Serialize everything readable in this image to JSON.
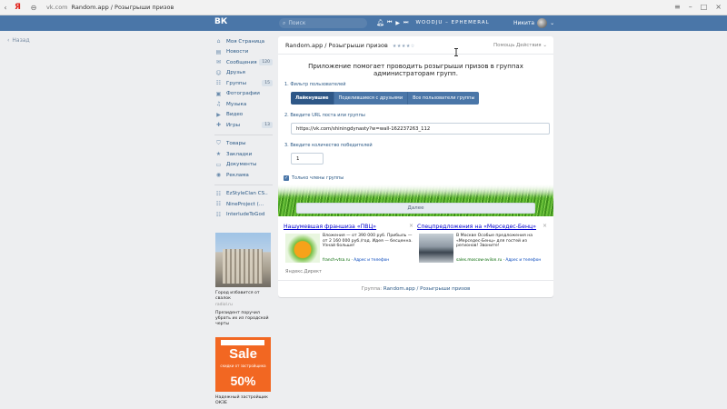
{
  "browser": {
    "logo": "Я",
    "domain": "vk.com",
    "page_title": "Random.app / Розыгрыши призов"
  },
  "header": {
    "logo": "ВК",
    "search_placeholder": "Поиск",
    "track": "WOODJU – EPHEMERAL",
    "user_name": "Никита"
  },
  "back_label": "Назад",
  "sidebar": {
    "items": [
      {
        "icon": "home-icon",
        "glyph": "⌂",
        "label": "Моя Страница",
        "count": ""
      },
      {
        "icon": "news-icon",
        "glyph": "▤",
        "label": "Новости",
        "count": ""
      },
      {
        "icon": "messages-icon",
        "glyph": "✉",
        "label": "Сообщения",
        "count": "120"
      },
      {
        "icon": "friends-icon",
        "glyph": "☺",
        "label": "Друзья",
        "count": ""
      },
      {
        "icon": "groups-icon",
        "glyph": "☷",
        "label": "Группы",
        "count": "15"
      },
      {
        "icon": "photos-icon",
        "glyph": "▣",
        "label": "Фотографии",
        "count": ""
      },
      {
        "icon": "music-icon",
        "glyph": "♫",
        "label": "Музыка",
        "count": ""
      },
      {
        "icon": "video-icon",
        "glyph": "▶",
        "label": "Видео",
        "count": ""
      },
      {
        "icon": "games-icon",
        "glyph": "✚",
        "label": "Игры",
        "count": "13"
      }
    ],
    "items2": [
      {
        "icon": "goods-icon",
        "glyph": "⛉",
        "label": "Товары"
      },
      {
        "icon": "bookmarks-icon",
        "glyph": "★",
        "label": "Закладки"
      },
      {
        "icon": "documents-icon",
        "glyph": "▭",
        "label": "Документы"
      },
      {
        "icon": "ads-icon",
        "glyph": "◉",
        "label": "Реклама"
      }
    ],
    "groups": [
      "EzStyleClan CS..",
      "NineProject (...",
      "InterludeToGod"
    ]
  },
  "ads": {
    "ad1": {
      "title": "Город избавится от свалок",
      "domain": "radiol.ru",
      "text": "Президент поручил убрать их из городской черты"
    },
    "ad2": {
      "sale": "Sale",
      "sub": "скидки от застройщика",
      "pct": "50%",
      "title": "Надежный застройщик ОКЗЕ"
    }
  },
  "app": {
    "title": "Random.app / Розыгрыши призов",
    "stars": "★★★★☆",
    "help": "Помощь",
    "actions": "Действия ⌄",
    "intro": "Приложение помогает проводить розыгрыши призов в группах администраторам групп.",
    "step1_label": "1. Фильтр пользователей",
    "filters": [
      "Лайкнувшие",
      "Поделившиеся с друзьями",
      "Все пользователи группы"
    ],
    "step2_label": "2. Введите URL поста или группы",
    "url_value": "https://vk.com/shiningdynasty?w=wall-162237263_112",
    "step3_label": "3. Введите количество победителей",
    "winners_value": "1",
    "only_members": "Только члены группы",
    "next_button": "Далее"
  },
  "direct": {
    "ad1": {
      "title": "Нашумевшая франшиза «ПВЦ»",
      "body": "Вложения — от 390 000 руб. Прибыль — от 2 160 000 руб./год. Идея — бесценна. Узнай больше!",
      "domain": "franch-vtsa.ru",
      "addr": "Адрес и телефон"
    },
    "ad2": {
      "title": "Спецпредложения на «Мерседес-Бенц»",
      "body": "В Москве Особые предложения на «Мерседес-Бенц» для гостей из регионов! Звоните!",
      "domain": "sales.moscow-avilon.ru",
      "addr": "Адрес и телефон"
    },
    "label": "Яндекс.Директ"
  },
  "footer": {
    "prefix": "Группа:",
    "link": "Random.app / Розыгрыши призов"
  }
}
